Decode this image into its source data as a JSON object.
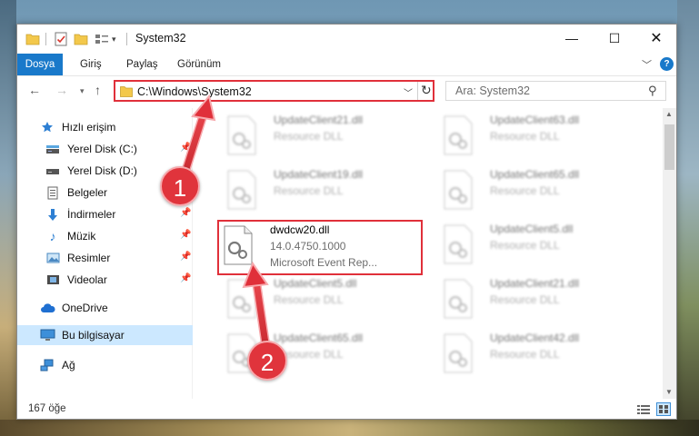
{
  "window": {
    "title": "System32",
    "controls": {
      "minimize": "—",
      "maximize": "☐",
      "close": "✕"
    }
  },
  "ribbon": {
    "tabs": [
      "Dosya",
      "Giriş",
      "Paylaş",
      "Görünüm"
    ],
    "help": "?"
  },
  "navigation": {
    "address": "C:\\Windows\\System32",
    "search_placeholder": "Ara: System32"
  },
  "sidebar": {
    "items": [
      {
        "label": "Hızlı erişim",
        "icon": "star-icon",
        "pinned": false
      },
      {
        "label": "Yerel Disk (C:)",
        "icon": "drive-icon",
        "pinned": true
      },
      {
        "label": "Yerel Disk (D:)",
        "icon": "drive-icon",
        "pinned": false
      },
      {
        "label": "Belgeler",
        "icon": "document-icon",
        "pinned": true
      },
      {
        "label": "İndirmeler",
        "icon": "download-icon",
        "pinned": true
      },
      {
        "label": "Müzik",
        "icon": "music-icon",
        "pinned": true
      },
      {
        "label": "Resimler",
        "icon": "pictures-icon",
        "pinned": true
      },
      {
        "label": "Videolar",
        "icon": "video-icon",
        "pinned": true
      },
      {
        "label": "OneDrive",
        "icon": "cloud-icon",
        "pinned": false
      },
      {
        "label": "Bu bilgisayar",
        "icon": "computer-icon",
        "pinned": false,
        "selected": true
      },
      {
        "label": "Ağ",
        "icon": "network-icon",
        "pinned": false
      }
    ]
  },
  "files": [
    {
      "name": "UpdateClient21.dll",
      "desc": "Resource DLL"
    },
    {
      "name": "UpdateClient63.dll",
      "desc": "Resource DLL"
    },
    {
      "name": "UpdateClient19.dll",
      "desc": "Resource DLL"
    },
    {
      "name": "UpdateClient65.dll",
      "desc": "Resource DLL"
    },
    {
      "name": "dwdcw20.dll",
      "version": "14.0.4750.1000",
      "desc": "Microsoft Event Rep...",
      "highlighted": true
    },
    {
      "name": "UpdateClient5.dll",
      "desc": "Resource DLL"
    },
    {
      "name": "UpdateClient5.dll",
      "desc": "Resource DLL"
    },
    {
      "name": "UpdateClient21.dll",
      "desc": "Resource DLL"
    },
    {
      "name": "UpdateClient65.dll",
      "desc": "Resource DLL"
    },
    {
      "name": "UpdateClient42.dll",
      "desc": "Resource DLL"
    }
  ],
  "status": {
    "count": "167 öğe"
  },
  "annotations": {
    "step1": "1",
    "step2": "2",
    "color": "#e0303a"
  }
}
